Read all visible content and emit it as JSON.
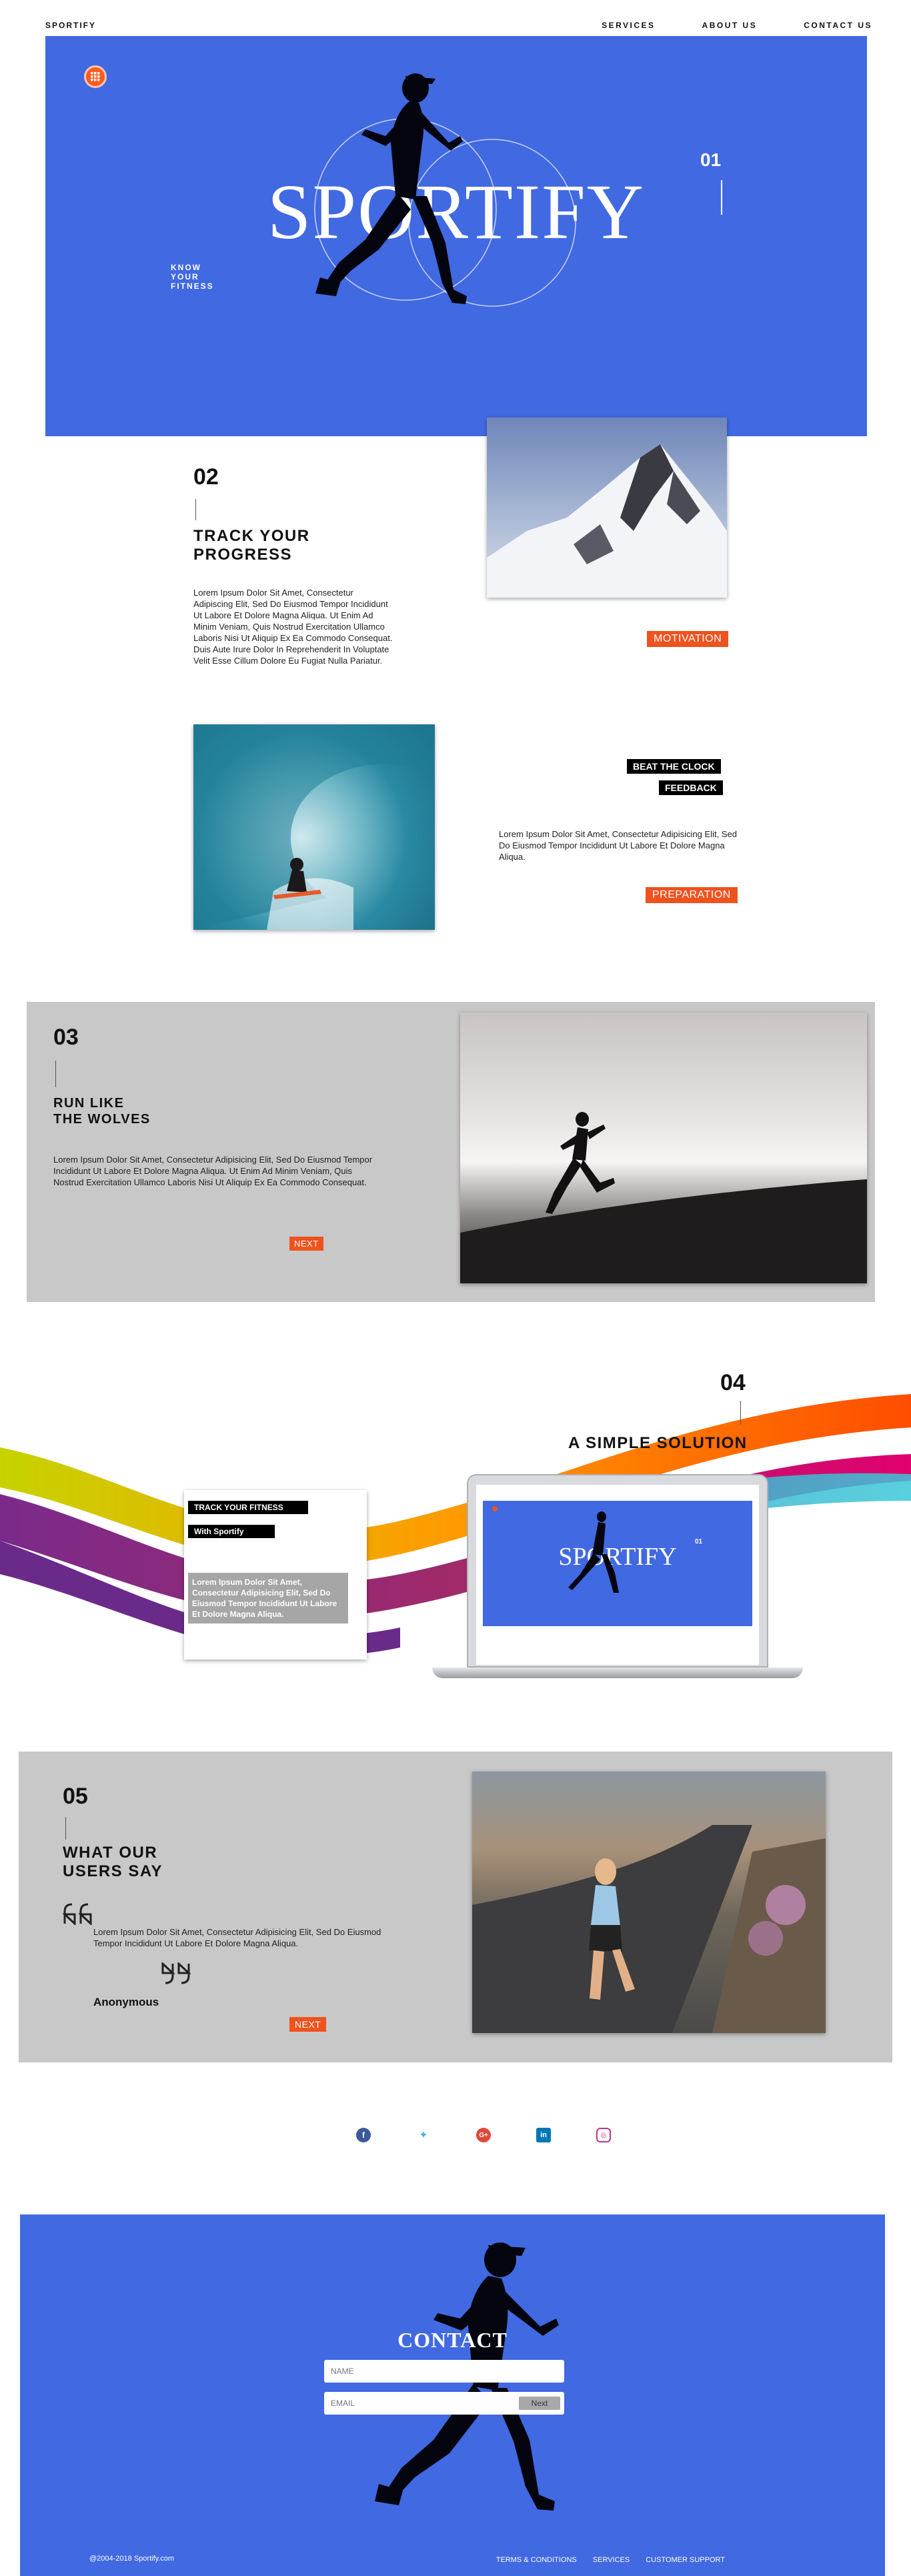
{
  "nav": {
    "brand": "SPORTIFY",
    "links": [
      "SERVICES",
      "ABOUT US",
      "CONTACT US"
    ]
  },
  "hero": {
    "title": "SPORTIFY",
    "number": "01",
    "tagline": "KNOW\nYOUR\nFITNESS"
  },
  "s02": {
    "number": "02",
    "heading": "TRACK YOUR\nPROGRESS",
    "text": "Lorem Ipsum Dolor Sit Amet, Consectetur Adipiscing Elit, Sed Do Eiusmod Tempor Incididunt Ut Labore Et Dolore Magna Aliqua. Ut Enim Ad Minim Veniam, Quis Nostrud Exercitation Ullamco Laboris Nisi Ut Aliquip Ex Ea Commodo Consequat. Duis Aute Irure Dolor In Reprehenderit In Voluptate Velit Esse Cillum Dolore Eu Fugiat Nulla Pariatur.",
    "motivation": "MOTIVATION",
    "beat": "BEAT THE CLOCK",
    "feedback": "FEEDBACK",
    "text2": "Lorem Ipsum Dolor Sit Amet, Consectetur Adipisicing Elit, Sed Do Eiusmod Tempor Incididunt Ut Labore Et Dolore Magna Aliqua.",
    "preparation": "PREPARATION"
  },
  "s03": {
    "number": "03",
    "heading": "RUN LIKE\nTHE WOLVES",
    "text": "Lorem Ipsum Dolor Sit Amet, Consectetur Adipisicing Elit, Sed Do Eiusmod Tempor Incididunt Ut Labore Et Dolore Magna Aliqua. Ut Enim Ad Minim Veniam, Quis Nostrud Exercitation Ullamco Laboris Nisi Ut Aliquip Ex Ea Commodo Consequat.",
    "next": "NEXT"
  },
  "s04": {
    "number": "04",
    "heading": "A SIMPLE SOLUTION",
    "card_tag1": "TRACK YOUR FITNESS",
    "card_tag2": "With Sportify",
    "card_text": "Lorem Ipsum Dolor Sit Amet, Consectetur Adipisicing Elit, Sed Do Eiusmod Tempor Incididunt Ut Labore Et Dolore Magna Aliqua.",
    "screen_title": "SPORTIFY",
    "screen_num": "01"
  },
  "s05": {
    "number": "05",
    "heading": "WHAT OUR\nUSERS SAY",
    "quote": "Lorem Ipsum Dolor Sit Amet, Consectetur Adipisicing Elit, Sed Do Eiusmod Tempor Incididunt Ut Labore Et Dolore Magna Aliqua.",
    "author": "Anonymous",
    "next": "NEXT"
  },
  "social": [
    "facebook-icon",
    "twitter-icon",
    "google-plus-icon",
    "linkedin-icon",
    "instagram-icon"
  ],
  "contact": {
    "title": "CONTACT",
    "name_placeholder": "NAME",
    "email_placeholder": "EMAIL",
    "next": "Next",
    "copyright": "@2004-2018 Sportify.com",
    "links": [
      "TERMS & CONDITIONS",
      "SERVICES",
      "CUSTOMER SUPPORT"
    ]
  },
  "colors": {
    "blue": "#4169e1",
    "orange": "#f0521e",
    "grey": "#c8c8c8"
  }
}
